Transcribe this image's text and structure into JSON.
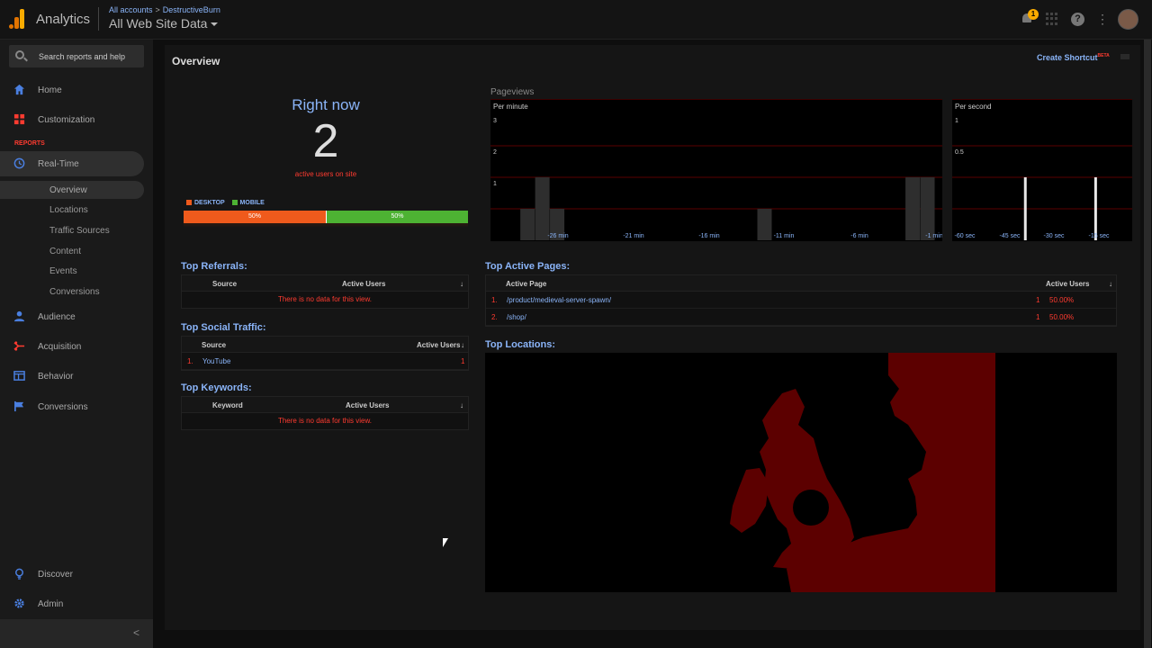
{
  "header": {
    "app_name": "Analytics",
    "breadcrumb_root": "All accounts",
    "breadcrumb_sep": ">",
    "breadcrumb_account": "DestructiveBurn",
    "view_name": "All Web Site Data",
    "notification_count": "1",
    "help_glyph": "?",
    "menu_glyph": "⋮"
  },
  "sidebar": {
    "search_placeholder": "Search reports and help",
    "home": "Home",
    "customization": "Customization",
    "reports_header": "REPORTS",
    "realtime": "Real-Time",
    "realtime_items": [
      "Overview",
      "Locations",
      "Traffic Sources",
      "Content",
      "Events",
      "Conversions"
    ],
    "audience": "Audience",
    "acquisition": "Acquisition",
    "behavior": "Behavior",
    "conversions": "Conversions",
    "discover": "Discover",
    "admin": "Admin",
    "collapse_glyph": "<"
  },
  "main": {
    "title": "Overview",
    "shortcut": "Create Shortcut",
    "shortcut_badge": "BETA",
    "right_now": {
      "title": "Right now",
      "count": "2",
      "subtitle": "active users on site",
      "legend_desktop": "DESKTOP",
      "legend_mobile": "MOBILE",
      "desktop_pct": "50%",
      "mobile_pct": "50%",
      "desktop_share": 0.5,
      "desktop_color": "#ef5a1c",
      "mobile_color": "#4db233"
    },
    "pageviews_title": "Pageviews",
    "top_referrals": {
      "title": "Top Referrals:",
      "col_source": "Source",
      "col_users": "Active Users",
      "empty": "There is no data for this view."
    },
    "top_social": {
      "title": "Top Social Traffic:",
      "col_source": "Source",
      "col_users": "Active Users",
      "rows": [
        {
          "rank": "1.",
          "source": "YouTube",
          "users": "1"
        }
      ]
    },
    "top_keywords": {
      "title": "Top Keywords:",
      "col_keyword": "Keyword",
      "col_users": "Active Users",
      "empty": "There is no data for this view."
    },
    "top_pages": {
      "title": "Top Active Pages:",
      "col_page": "Active Page",
      "col_users": "Active Users",
      "rows": [
        {
          "rank": "1.",
          "page": "/product/medieval-server-spawn/",
          "users": "1",
          "pct": "50.00%"
        },
        {
          "rank": "2.",
          "page": "/shop/",
          "users": "1",
          "pct": "50.00%"
        }
      ]
    },
    "top_locations_title": "Top Locations:"
  },
  "chart_data": [
    {
      "type": "bar",
      "title": "Per minute",
      "x_tick_labels": [
        "-26 min",
        "-21 min",
        "-16 min",
        "-11 min",
        "-6 min",
        "-1 min"
      ],
      "y_tick_labels": [
        "1",
        "2",
        "3"
      ],
      "ylim": [
        0,
        4
      ],
      "minutes_ago": [
        -28,
        -27,
        -26,
        -12,
        -2,
        -1
      ],
      "values": [
        1,
        2,
        1,
        1,
        2,
        2
      ]
    },
    {
      "type": "bar",
      "title": "Per second",
      "x_tick_labels": [
        "-60 sec",
        "-45 sec",
        "-30 sec",
        "-15 sec"
      ],
      "y_tick_labels": [
        "0.5",
        "1",
        "1.5"
      ],
      "ylim": [
        0,
        2
      ],
      "seconds_ago": [
        -38,
        -13
      ],
      "values": [
        1,
        1
      ]
    }
  ]
}
